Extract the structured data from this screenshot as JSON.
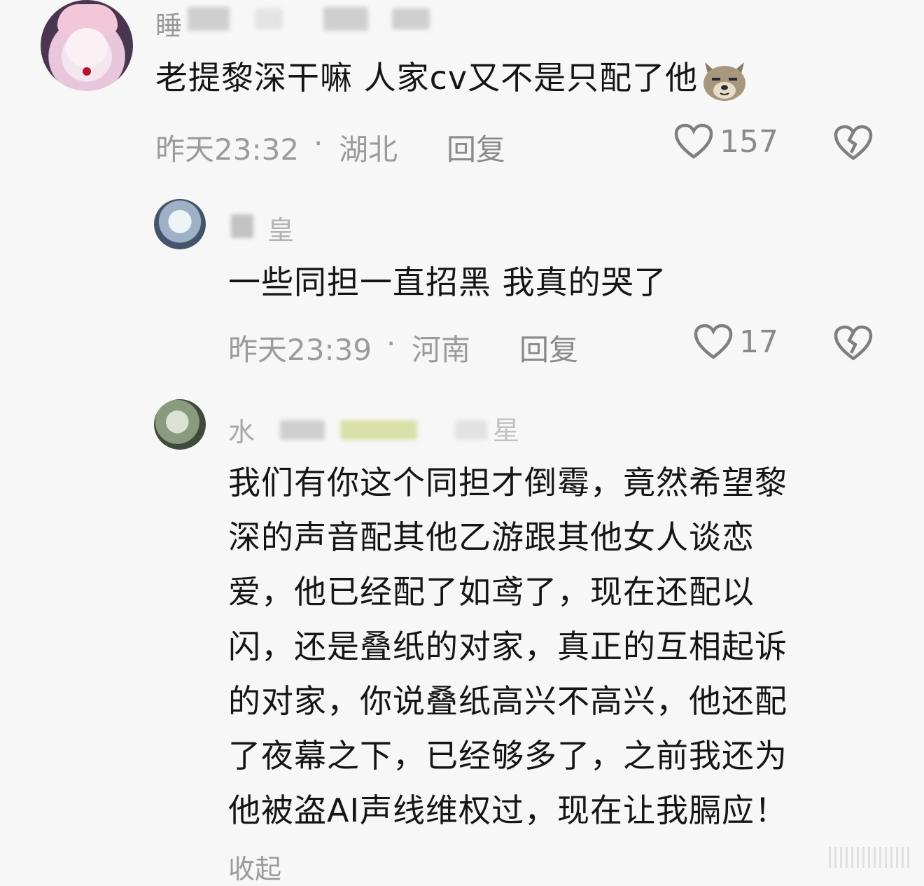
{
  "comments": [
    {
      "username_visible": "睡",
      "text": "老提黎深干嘛 人家cv又不是只配了他",
      "emoji": "dog-emoji",
      "time": "昨天23:32",
      "location": "湖北",
      "reply_label": "回复",
      "likes": "157"
    },
    {
      "username_visible": "皇",
      "text": "一些同担一直招黑 我真的哭了",
      "time": "昨天23:39",
      "location": "河南",
      "reply_label": "回复",
      "likes": "17"
    },
    {
      "username_visible_start": "水",
      "username_visible_end": "星",
      "text_lines": [
        "我们有你这个同担才倒霉，竟然希望黎",
        "深的声音配其他乙游跟其他女人谈恋",
        "爱，他已经配了如鸢了，现在还配以",
        "闪，还是叠纸的对家，真正的互相起诉",
        "的对家，你说叠纸高兴不高兴，他还配",
        "了夜幕之下，已经够多了，之前我还为",
        "他被盗AI声线维权过，现在让我膈应！"
      ],
      "collapse_label": "收起"
    }
  ],
  "separator": "·",
  "icons": {
    "like": "heart-outline-icon",
    "dislike": "broken-heart-icon"
  }
}
